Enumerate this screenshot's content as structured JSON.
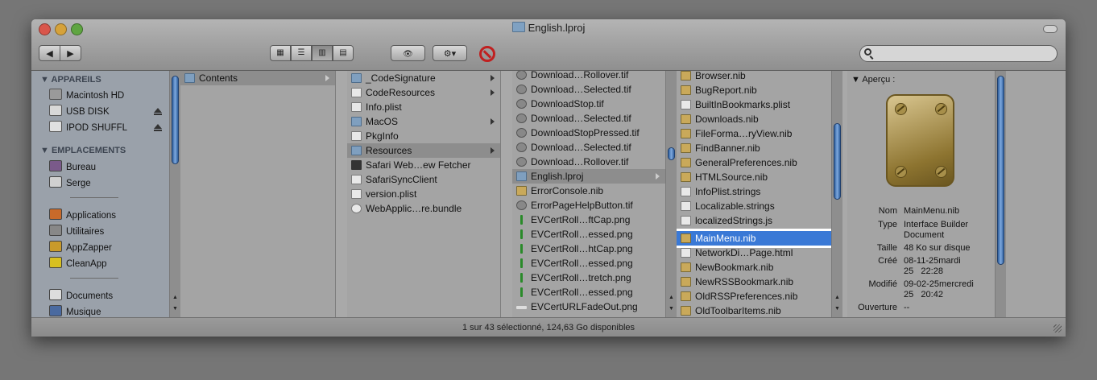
{
  "window": {
    "title": "English.lproj"
  },
  "toolbar": {
    "back": "◀",
    "forward": "▶",
    "view_icon": "▦",
    "view_list": "☰",
    "view_columns": "▥",
    "view_coverflow": "▤",
    "quicklook": "👁",
    "action": "⚙▾",
    "stop": "⃠"
  },
  "search": {
    "value": "",
    "placeholder": ""
  },
  "sidebar": {
    "devices_header": "▼ APPAREILS",
    "devices": [
      {
        "label": "Macintosh HD",
        "eject": false
      },
      {
        "label": "USB DISK",
        "eject": true
      },
      {
        "label": "IPOD SHUFFL",
        "eject": true
      }
    ],
    "places_header": "▼ EMPLACEMENTS",
    "places": [
      "Bureau",
      "Serge"
    ],
    "apps": [
      "Applications",
      "Utilitaires",
      "AppZapper",
      "CleanApp"
    ],
    "docs": [
      "Documents",
      "Musique"
    ]
  },
  "col1": {
    "items": [
      "Contents"
    ]
  },
  "col2": {
    "items": [
      "_CodeSignature",
      "CodeResources",
      "Info.plist",
      "MacOS",
      "PkgInfo",
      "Resources",
      "Safari Web…ew Fetcher",
      "SafariSyncClient",
      "version.plist",
      "WebApplic…re.bundle"
    ]
  },
  "col3": {
    "items": [
      "Download…Rollover.tif",
      "Download…Selected.tif",
      "DownloadStop.tif",
      "Download…Selected.tif",
      "DownloadStopPressed.tif",
      "Download…Selected.tif",
      "Download…Rollover.tif",
      "English.lproj",
      "ErrorConsole.nib",
      "ErrorPageHelpButton.tif",
      "EVCertRoll…ftCap.png",
      "EVCertRoll…essed.png",
      "EVCertRoll…htCap.png",
      "EVCertRoll…essed.png",
      "EVCertRoll…tretch.png",
      "EVCertRoll…essed.png",
      "EVCertURLFadeOut.png"
    ]
  },
  "col4": {
    "items": [
      "Browser.nib",
      "BugReport.nib",
      "BuiltInBookmarks.plist",
      "Downloads.nib",
      "FileForma…ryView.nib",
      "FindBanner.nib",
      "GeneralPreferences.nib",
      "HTMLSource.nib",
      "InfoPlist.strings",
      "Localizable.strings",
      "localizedStrings.js",
      "MainMenu.nib",
      "NetworkDi…Page.html",
      "NewBookmark.nib",
      "NewRSSBookmark.nib",
      "OldRSSPreferences.nib",
      "OldToolbarItems.nib"
    ]
  },
  "preview": {
    "header": "▼ Aperçu :",
    "nom_k": "Nom",
    "nom_v": "MainMenu.nib",
    "type_k": "Type",
    "type_v1": "Interface Builder",
    "type_v2": "Document",
    "taille_k": "Taille",
    "taille_v": "48 Ko sur disque",
    "cree_k": "Créé",
    "cree_v1": "08-11-25mardi",
    "cree_v2": "25   22:28",
    "modifie_k": "Modifié",
    "modifie_v1": "09-02-25mercredi",
    "modifie_v2": "25   20:42",
    "ouverture_k": "Ouverture",
    "ouverture_v": "--"
  },
  "status": {
    "text": "1 sur 43 sélectionné, 124,63 Go disponibles"
  },
  "colors": {
    "selection": "#3a79d6",
    "titlebar": "#a6a6a6"
  }
}
